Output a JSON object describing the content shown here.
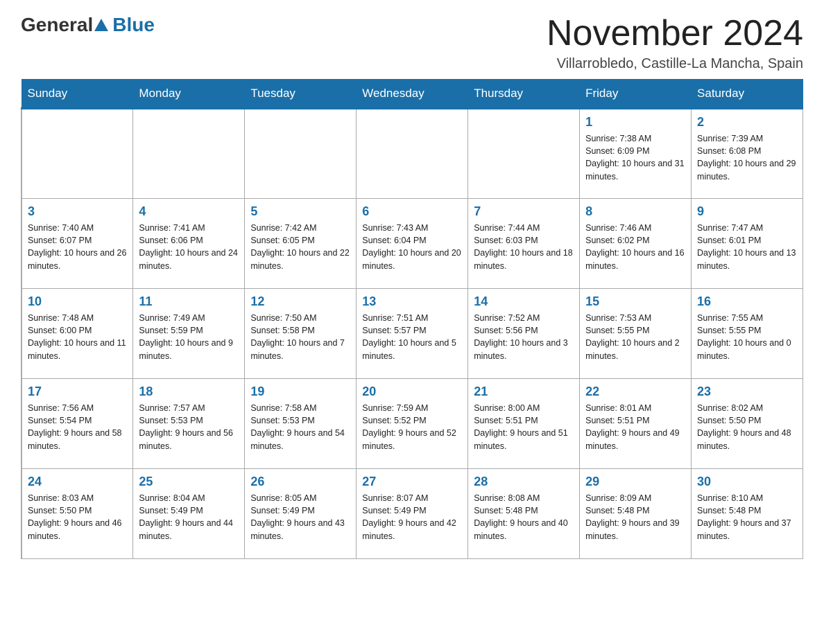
{
  "header": {
    "logo_general": "General",
    "logo_blue": "Blue",
    "title": "November 2024",
    "location": "Villarrobledo, Castille-La Mancha, Spain"
  },
  "calendar": {
    "days_of_week": [
      "Sunday",
      "Monday",
      "Tuesday",
      "Wednesday",
      "Thursday",
      "Friday",
      "Saturday"
    ],
    "weeks": [
      [
        {
          "day": "",
          "info": ""
        },
        {
          "day": "",
          "info": ""
        },
        {
          "day": "",
          "info": ""
        },
        {
          "day": "",
          "info": ""
        },
        {
          "day": "",
          "info": ""
        },
        {
          "day": "1",
          "info": "Sunrise: 7:38 AM\nSunset: 6:09 PM\nDaylight: 10 hours and 31 minutes."
        },
        {
          "day": "2",
          "info": "Sunrise: 7:39 AM\nSunset: 6:08 PM\nDaylight: 10 hours and 29 minutes."
        }
      ],
      [
        {
          "day": "3",
          "info": "Sunrise: 7:40 AM\nSunset: 6:07 PM\nDaylight: 10 hours and 26 minutes."
        },
        {
          "day": "4",
          "info": "Sunrise: 7:41 AM\nSunset: 6:06 PM\nDaylight: 10 hours and 24 minutes."
        },
        {
          "day": "5",
          "info": "Sunrise: 7:42 AM\nSunset: 6:05 PM\nDaylight: 10 hours and 22 minutes."
        },
        {
          "day": "6",
          "info": "Sunrise: 7:43 AM\nSunset: 6:04 PM\nDaylight: 10 hours and 20 minutes."
        },
        {
          "day": "7",
          "info": "Sunrise: 7:44 AM\nSunset: 6:03 PM\nDaylight: 10 hours and 18 minutes."
        },
        {
          "day": "8",
          "info": "Sunrise: 7:46 AM\nSunset: 6:02 PM\nDaylight: 10 hours and 16 minutes."
        },
        {
          "day": "9",
          "info": "Sunrise: 7:47 AM\nSunset: 6:01 PM\nDaylight: 10 hours and 13 minutes."
        }
      ],
      [
        {
          "day": "10",
          "info": "Sunrise: 7:48 AM\nSunset: 6:00 PM\nDaylight: 10 hours and 11 minutes."
        },
        {
          "day": "11",
          "info": "Sunrise: 7:49 AM\nSunset: 5:59 PM\nDaylight: 10 hours and 9 minutes."
        },
        {
          "day": "12",
          "info": "Sunrise: 7:50 AM\nSunset: 5:58 PM\nDaylight: 10 hours and 7 minutes."
        },
        {
          "day": "13",
          "info": "Sunrise: 7:51 AM\nSunset: 5:57 PM\nDaylight: 10 hours and 5 minutes."
        },
        {
          "day": "14",
          "info": "Sunrise: 7:52 AM\nSunset: 5:56 PM\nDaylight: 10 hours and 3 minutes."
        },
        {
          "day": "15",
          "info": "Sunrise: 7:53 AM\nSunset: 5:55 PM\nDaylight: 10 hours and 2 minutes."
        },
        {
          "day": "16",
          "info": "Sunrise: 7:55 AM\nSunset: 5:55 PM\nDaylight: 10 hours and 0 minutes."
        }
      ],
      [
        {
          "day": "17",
          "info": "Sunrise: 7:56 AM\nSunset: 5:54 PM\nDaylight: 9 hours and 58 minutes."
        },
        {
          "day": "18",
          "info": "Sunrise: 7:57 AM\nSunset: 5:53 PM\nDaylight: 9 hours and 56 minutes."
        },
        {
          "day": "19",
          "info": "Sunrise: 7:58 AM\nSunset: 5:53 PM\nDaylight: 9 hours and 54 minutes."
        },
        {
          "day": "20",
          "info": "Sunrise: 7:59 AM\nSunset: 5:52 PM\nDaylight: 9 hours and 52 minutes."
        },
        {
          "day": "21",
          "info": "Sunrise: 8:00 AM\nSunset: 5:51 PM\nDaylight: 9 hours and 51 minutes."
        },
        {
          "day": "22",
          "info": "Sunrise: 8:01 AM\nSunset: 5:51 PM\nDaylight: 9 hours and 49 minutes."
        },
        {
          "day": "23",
          "info": "Sunrise: 8:02 AM\nSunset: 5:50 PM\nDaylight: 9 hours and 48 minutes."
        }
      ],
      [
        {
          "day": "24",
          "info": "Sunrise: 8:03 AM\nSunset: 5:50 PM\nDaylight: 9 hours and 46 minutes."
        },
        {
          "day": "25",
          "info": "Sunrise: 8:04 AM\nSunset: 5:49 PM\nDaylight: 9 hours and 44 minutes."
        },
        {
          "day": "26",
          "info": "Sunrise: 8:05 AM\nSunset: 5:49 PM\nDaylight: 9 hours and 43 minutes."
        },
        {
          "day": "27",
          "info": "Sunrise: 8:07 AM\nSunset: 5:49 PM\nDaylight: 9 hours and 42 minutes."
        },
        {
          "day": "28",
          "info": "Sunrise: 8:08 AM\nSunset: 5:48 PM\nDaylight: 9 hours and 40 minutes."
        },
        {
          "day": "29",
          "info": "Sunrise: 8:09 AM\nSunset: 5:48 PM\nDaylight: 9 hours and 39 minutes."
        },
        {
          "day": "30",
          "info": "Sunrise: 8:10 AM\nSunset: 5:48 PM\nDaylight: 9 hours and 37 minutes."
        }
      ]
    ]
  }
}
